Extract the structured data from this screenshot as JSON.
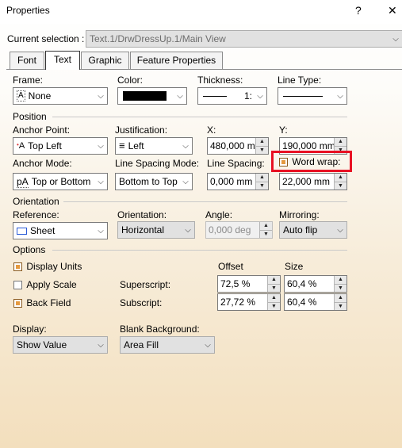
{
  "window": {
    "title": "Properties",
    "help_label": "?",
    "close_label": "✕"
  },
  "selection": {
    "label": "Current selection :",
    "value": "Text.1/DrwDressUp.1/Main View"
  },
  "tabs": [
    {
      "label": "Font"
    },
    {
      "label": "Text"
    },
    {
      "label": "Graphic"
    },
    {
      "label": "Feature Properties"
    }
  ],
  "frame": {
    "label": "Frame:",
    "value": "None"
  },
  "color": {
    "label": "Color:",
    "value": "#000000"
  },
  "thickness": {
    "label": "Thickness:",
    "value": "1:"
  },
  "line_type": {
    "label": "Line Type:"
  },
  "position": {
    "section": "Position",
    "anchor_point": {
      "label": "Anchor Point:",
      "value": "Top Left"
    },
    "justification": {
      "label": "Justification:",
      "value": "Left"
    },
    "x": {
      "label": "X:",
      "value": "480,000 mm"
    },
    "y": {
      "label": "Y:",
      "value": "190,000 mm"
    },
    "anchor_mode": {
      "label": "Anchor Mode:",
      "value": "Top or Bottom"
    },
    "line_spacing_mode": {
      "label": "Line Spacing Mode:",
      "value": "Bottom to Top"
    },
    "line_spacing": {
      "label": "Line Spacing:",
      "value": "0,000 mm"
    },
    "word_wrap": {
      "label": "Word wrap:",
      "value": "22,000 mm",
      "checked": true,
      "highlight_color": "#e81123"
    }
  },
  "orientation": {
    "section": "Orientation",
    "reference": {
      "label": "Reference:",
      "value": "Sheet"
    },
    "orientation": {
      "label": "Orientation:",
      "value": "Horizontal"
    },
    "angle": {
      "label": "Angle:",
      "value": "0,000 deg"
    },
    "mirroring": {
      "label": "Mirroring:",
      "value": "Auto flip"
    }
  },
  "options": {
    "section": "Options",
    "offset_header": "Offset",
    "size_header": "Size",
    "display_units": {
      "label": "Display Units",
      "checked": true
    },
    "apply_scale": {
      "label": "Apply Scale",
      "checked": false
    },
    "back_field": {
      "label": "Back Field",
      "checked": true
    },
    "superscript": {
      "label": "Superscript:",
      "offset": "72,5 %",
      "size": "60,4 %"
    },
    "subscript": {
      "label": "Subscript:",
      "offset": "27,72 %",
      "size": "60,4 %"
    }
  },
  "display": {
    "label": "Display:",
    "value": "Show Value"
  },
  "blank_background": {
    "label": "Blank Background:",
    "value": "Area Fill"
  },
  "colors": {
    "accent_check": "#e59a40"
  }
}
